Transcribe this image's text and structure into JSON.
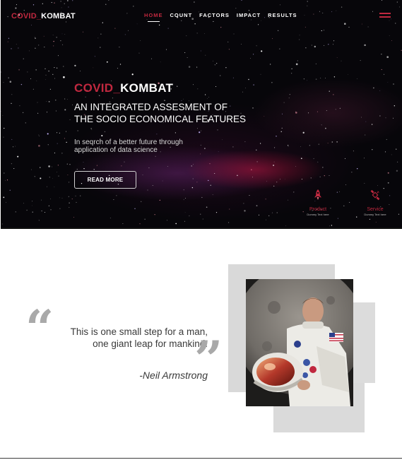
{
  "brand": {
    "part1": "COVID_",
    "part2": "KOMBAT"
  },
  "nav": {
    "items": [
      {
        "label": "HOME",
        "active": true
      },
      {
        "label": "COUNT",
        "active": false
      },
      {
        "label": "FACTORS",
        "active": false
      },
      {
        "label": "IMPACT",
        "active": false
      },
      {
        "label": "RESULTS",
        "active": false
      }
    ]
  },
  "hero": {
    "title_part1": "COVID_",
    "title_part2": "KOMBAT",
    "subtitle_line1": "AN INTEGRATED ASSESMENT OF",
    "subtitle_line2": "THE SOCIO ECONOMICAL FEATURES",
    "desc_line1": "In seqrch of a better future through",
    "desc_line2": "application of data science",
    "button_label": "READ MORE",
    "features": [
      {
        "icon": "rocket-icon",
        "title": "Product",
        "sub": "Dummy Text here"
      },
      {
        "icon": "satellite-icon",
        "title": "Service",
        "sub": "Dummy Text here"
      }
    ]
  },
  "quote": {
    "line1": "This is one small step for a man,",
    "line2": "one giant leap for mankind.",
    "author": "-Neil Armstrong",
    "open_mark": "“",
    "close_mark": "”"
  },
  "colors": {
    "accent": "#c0283f",
    "hero_bg": "#07060a",
    "quote_mark": "#a9a9a9",
    "block_gray": "#d9d9d9"
  }
}
